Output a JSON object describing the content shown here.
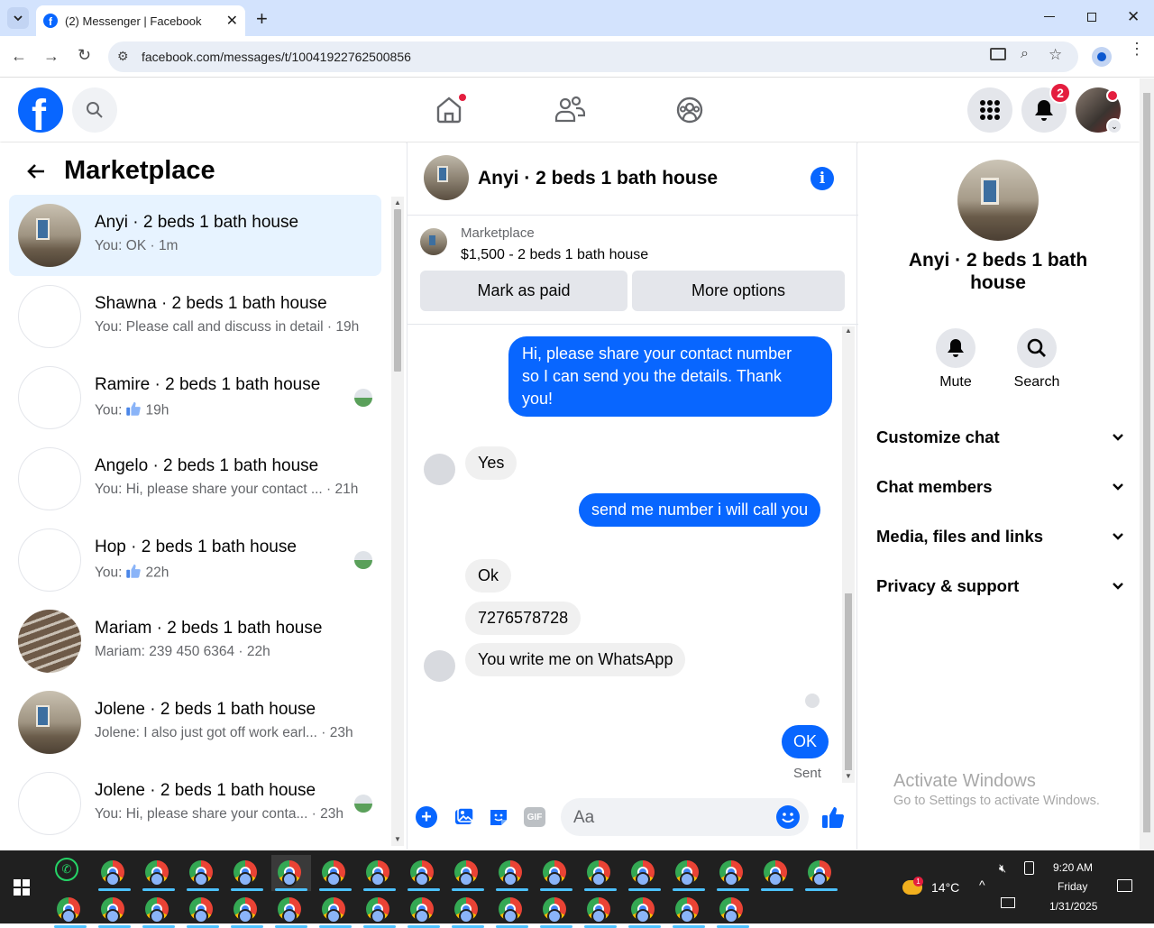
{
  "browser": {
    "tab_title": "(2) Messenger | Facebook",
    "url": "facebook.com/messages/t/10041922762500856"
  },
  "header": {
    "notification_count": "2"
  },
  "left_panel": {
    "title": "Marketplace",
    "conversations": [
      {
        "name": "Anyi · 2 beds 1 bath house",
        "preview": "You: OK · 1m",
        "avatar": "room"
      },
      {
        "name": "Shawna · 2 beds 1 bath house",
        "preview": "You: Please call and discuss in detail · 19h",
        "avatar": "blank"
      },
      {
        "name": "Ramire · 2 beds 1 bath house",
        "preview": "You:",
        "preview_time": "19h",
        "avatar": "blank"
      },
      {
        "name": "Angelo · 2 beds 1 bath house",
        "preview": "You: Hi, please share your contact ... · 21h",
        "avatar": "blank"
      },
      {
        "name": "Hop · 2 beds 1 bath house",
        "preview": "You:",
        "preview_time": "22h",
        "avatar": "blank"
      },
      {
        "name": "Mariam · 2 beds 1 bath house",
        "preview": "Mariam: 239 450 6364 · 22h",
        "avatar": "stairs"
      },
      {
        "name": "Jolene · 2 beds 1 bath house",
        "preview": "Jolene: I also just got off work earl... · 23h",
        "avatar": "room"
      },
      {
        "name": "Jolene · 2 beds 1 bath house",
        "preview": "You: Hi, please share your conta... · 23h",
        "avatar": "blank"
      }
    ]
  },
  "chat": {
    "title": "Anyi · 2 beds 1 bath house",
    "listing": {
      "source": "Marketplace",
      "summary": "$1,500 - 2 beds 1 bath house"
    },
    "mark_paid_label": "Mark as paid",
    "more_options_label": "More options",
    "messages": [
      {
        "from": "me",
        "lines": [
          "Hi, please share your contact number",
          "so I can send you the details. Thank",
          "you!"
        ]
      },
      {
        "from": "them",
        "text": "Yes"
      },
      {
        "from": "me",
        "text": "send me number i will call you"
      },
      {
        "from": "them",
        "text": "Ok"
      },
      {
        "from": "them",
        "text": "7276578728"
      },
      {
        "from": "them",
        "text": "You write me on WhatsApp"
      },
      {
        "from": "me",
        "text": "OK"
      }
    ],
    "status": "Sent",
    "composer_placeholder": "Aa"
  },
  "right_panel": {
    "title": "Anyi · 2 beds 1 bath house",
    "mute_label": "Mute",
    "search_label": "Search",
    "sections": [
      "Customize chat",
      "Chat members",
      "Media, files and links",
      "Privacy & support"
    ],
    "watermark_title": "Activate Windows",
    "watermark_sub": "Go to Settings to activate Windows."
  },
  "taskbar": {
    "temperature": "14°C",
    "time": "9:20 AM",
    "day": "Friday",
    "date": "1/31/2025",
    "weather_badge": "1"
  },
  "colors": {
    "fb_blue": "#0866ff",
    "selected_row": "#e7f3ff",
    "badge_red": "#e41e3f"
  }
}
